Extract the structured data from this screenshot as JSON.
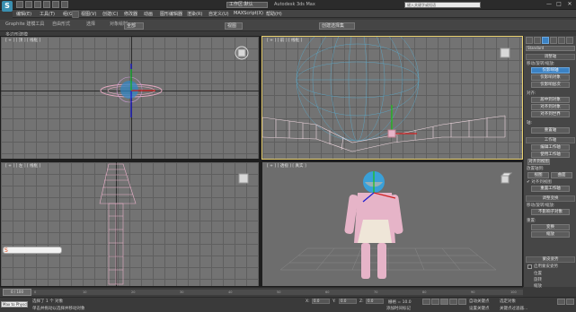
{
  "title_bar": {
    "app_logo": "S",
    "workspace": "工作区:默认",
    "window_title": "Autodesk 3ds Max",
    "search_placeholder": "键入关键字或短语",
    "controls": [
      "—",
      "□",
      "✕"
    ]
  },
  "menu": {
    "items": [
      "编辑(E)",
      "工具(T)",
      "组(G)",
      "视图(V)",
      "创建(C)",
      "修改器",
      "动画",
      "图形编辑器",
      "渲染(R)",
      "自定义(U)",
      "MAXScript(X)",
      "帮助(H)"
    ]
  },
  "toolbar": {
    "filter_select": "全部",
    "view_select": "视图",
    "selection_set": "创建选择集"
  },
  "ribbon": {
    "tabs": [
      "Graphite 建模工具",
      "自由形式",
      "选择",
      "对象绘制"
    ],
    "sub_label": "多边形建模"
  },
  "viewports": {
    "top": "[ + ] [ 顶 ] [ 线框 ]",
    "front": "[ + ] [ 前 ] [ 线框 ]",
    "left": "[ + ] [ 左 ] [ 线框 ]",
    "perspective": "[ + ] [ 透视 ] [ 真实 ]"
  },
  "command_panel": {
    "category": "Standard",
    "rollouts": {
      "adjust_pivot": "调整轴",
      "move_rotate_scale": "移动/旋转/缩放:",
      "affect_pivot_only": "仅影响轴",
      "affect_object_only": "仅影响对象",
      "affect_hierarchy_only": "仅影响层次",
      "alignment": "对齐:",
      "center_to_object": "居中到对象",
      "align_to_object": "对齐到对象",
      "align_to_world": "对齐到世界",
      "pivot": "轴:",
      "reset_pivot": "重置轴",
      "working_pivot": "工作轴",
      "edit_working_pivot": "编辑工作轴",
      "use_working_pivot": "使用工作轴",
      "align_to_view": "对齐到视图",
      "place_pivot_to": "放置轴到:",
      "view": "视图",
      "surface": "曲面",
      "align_to_view_chk": "✔ 对齐到视图",
      "reset_working_pivot": "重置工作轴",
      "adjust_transform": "调整变换",
      "move_rotate_scale2": "移动/旋转/缩放:",
      "dont_affect_children": "不影响子对象",
      "reset": "重置:",
      "transform": "变换",
      "scale": "缩放",
      "skin_pose": "蒙皮姿势",
      "enable_skin_pose": "启用蒙皮姿势",
      "position": "位置",
      "rotation": "旋转",
      "scale2": "缩放"
    }
  },
  "timeline": {
    "frame_counter": "0 / 100",
    "ticks": [
      "0",
      "10",
      "20",
      "30",
      "40",
      "50",
      "60",
      "70",
      "80",
      "90",
      "100"
    ]
  },
  "status_bar": {
    "maxscript": "Max to Physcl",
    "selection": "选择了 1 个 对象",
    "prompt": "单击并拖动以选择并移动对象",
    "x_label": "X:",
    "x_value": "0.0",
    "y_label": "Y:",
    "y_value": "0.0",
    "z_label": "Z:",
    "z_value": "0.0",
    "grid": "栅格 = 10.0",
    "auto_key": "自动关键点",
    "set_key": "设置关键点",
    "selected": "选定对象",
    "key_filters": "关键点过滤器...",
    "add_time_tag": "添加时间标记"
  },
  "colors": {
    "viewport_bg": "#737373",
    "active_border": "#e8d070",
    "accent": "#3b82c4",
    "body_pink": "#e6b4c8",
    "head_blue": "#3aa0d8"
  }
}
